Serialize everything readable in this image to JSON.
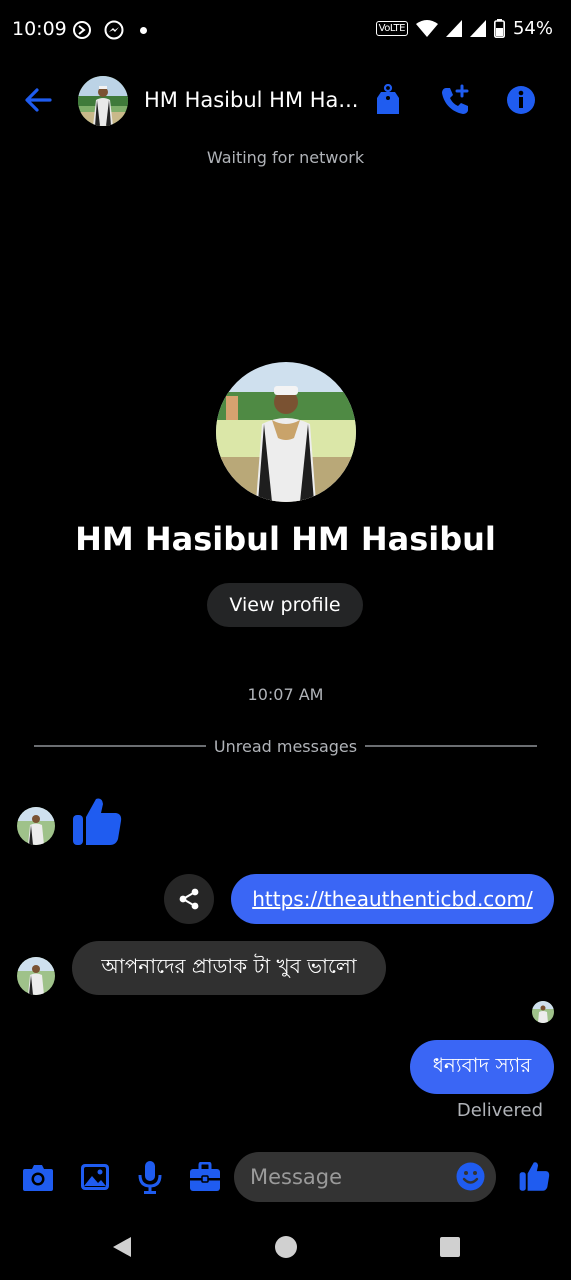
{
  "status_bar": {
    "time": "10:09",
    "volte": "VoLTE",
    "battery": "54%"
  },
  "header": {
    "title": "HM Hasibul HM Ha...",
    "connection_status": "Waiting for network"
  },
  "profile": {
    "name": "HM Hasibul HM Hasibul",
    "view_profile_label": "View profile"
  },
  "conversation": {
    "timestamp": "10:07 AM",
    "unread_label": "Unread messages",
    "messages": [
      {
        "direction": "incoming",
        "type": "like"
      },
      {
        "direction": "outgoing",
        "type": "link",
        "text": "https://theauthenticbd.com/"
      },
      {
        "direction": "incoming",
        "type": "text",
        "text": "আপনাদের প্রাডাক টা খুব ভালো"
      },
      {
        "direction": "outgoing",
        "type": "text",
        "text": "ধন্যবাদ স্যার"
      }
    ],
    "delivery_status": "Delivered"
  },
  "composer": {
    "placeholder": "Message",
    "icons": [
      "camera-icon",
      "image-icon",
      "microphone-icon",
      "briefcase-icon",
      "emoji-icon",
      "like-icon"
    ]
  },
  "colors": {
    "accent": "#3a66f5",
    "icon_blue": "#1f5cf0",
    "background": "#000000",
    "incoming_bubble": "#303030"
  }
}
